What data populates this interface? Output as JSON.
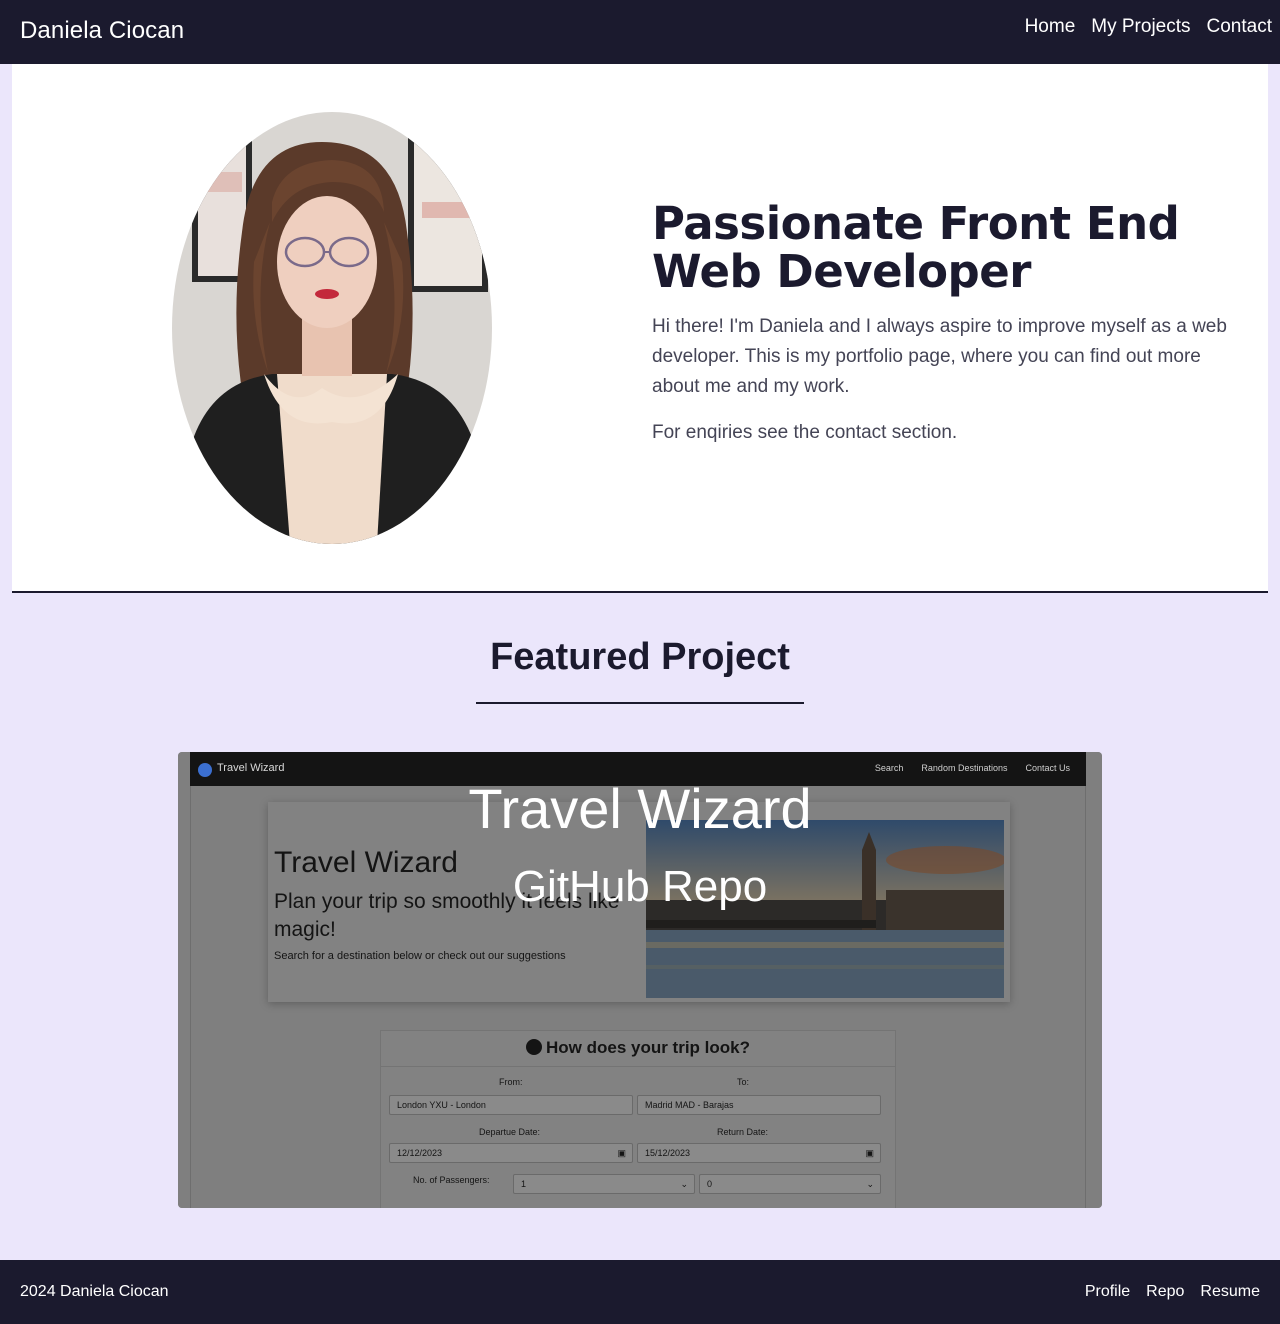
{
  "nav": {
    "brand": "Daniela Ciocan",
    "links": [
      "Home",
      "My Projects",
      "Contact"
    ]
  },
  "hero": {
    "title": "Passionate Front End Web Developer",
    "intro": "Hi there! I'm Daniela and I always aspire to improve myself as a web developer. This is my portfolio page, where you can find out more about me and my work.",
    "enquiries": "For enqiries see the contact section."
  },
  "featured": {
    "title": "Featured Project",
    "project_title": "Travel Wizard",
    "repo_link": "GitHub Repo",
    "screenshot": {
      "brand": "Travel Wizard",
      "nav_links": [
        "Search",
        "Random Destinations",
        "Contact Us"
      ],
      "hero_title": "Travel Wizard",
      "hero_subtitle": "Plan your trip so smoothly it feels like magic!",
      "hero_small": "Search for a destination below or check out our suggestions",
      "form_heading": "How does your trip look?",
      "from_label": "From:",
      "from_value": "London YXU - London",
      "to_label": "To:",
      "to_value": "Madrid MAD - Barajas",
      "departure_label": "Departue Date:",
      "departure_value": "12/12/2023",
      "return_label": "Return Date:",
      "return_value": "15/12/2023",
      "passengers_label": "No. of Passengers:",
      "passengers_value": "1",
      "second_select_value": "0"
    }
  },
  "footer": {
    "copyright": "2024 Daniela Ciocan",
    "links": [
      "Profile",
      "Repo",
      "Resume"
    ]
  },
  "colors": {
    "navy": "#1b1a2e",
    "lavender": "#ebe6fb",
    "white": "#ffffff"
  }
}
